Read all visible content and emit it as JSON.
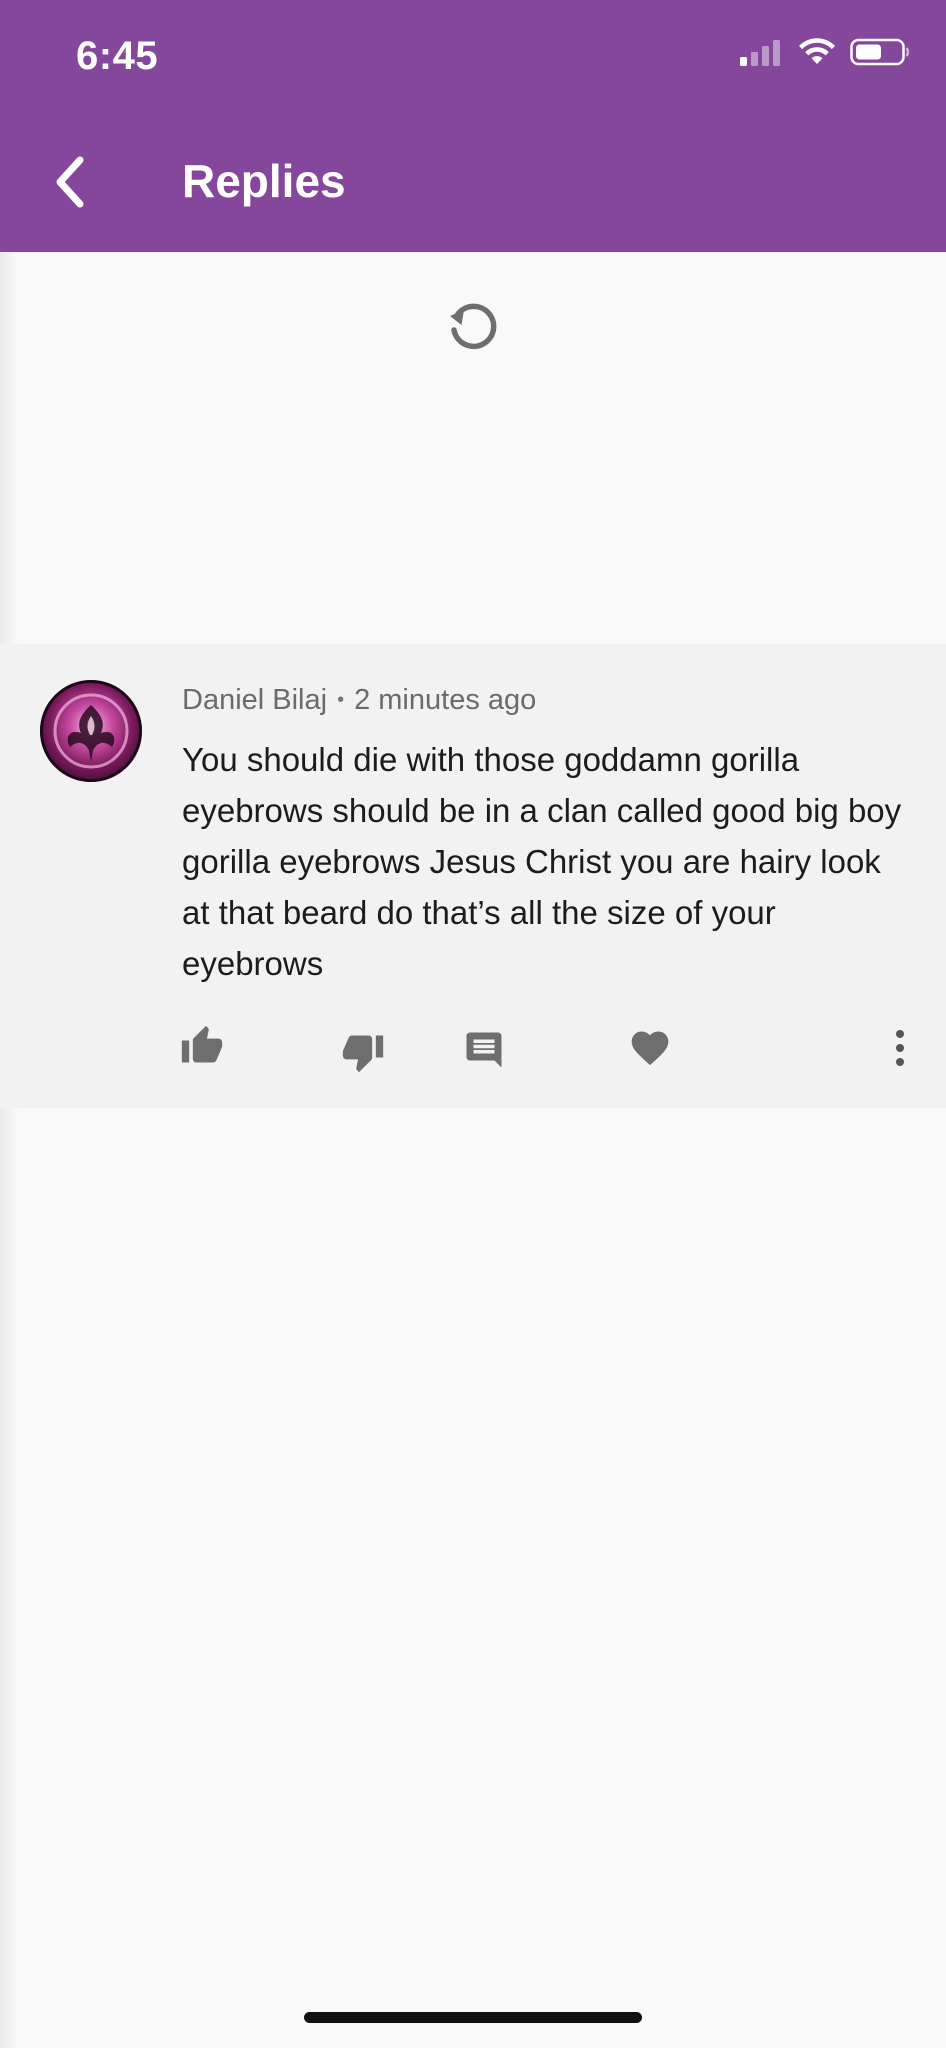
{
  "status_bar": {
    "time": "6:45",
    "icons": [
      "cellular-signal-icon",
      "wifi-icon",
      "battery-icon"
    ]
  },
  "app_bar": {
    "title": "Replies",
    "back_icon": "chevron-left-icon",
    "color": "#85479b"
  },
  "loader": {
    "icon": "reload-icon"
  },
  "comment": {
    "author": "Daniel Bilaj",
    "separator": "•",
    "time_ago": "2 minutes ago",
    "text": "You should die with those goddamn gorilla eyebrows should be in a clan called good big boy gorilla eyebrows Jesus Christ you are hairy look at that beard do that’s all the size of your eyebrows",
    "actions": [
      "thumb-up-icon",
      "thumb-down-icon",
      "reply-comment-icon",
      "heart-icon",
      "more-vertical-icon"
    ]
  },
  "colors": {
    "page_background": "#f9f9f9",
    "comment_background": "#f2f2f2",
    "icon_gray": "#6e6e6e"
  }
}
